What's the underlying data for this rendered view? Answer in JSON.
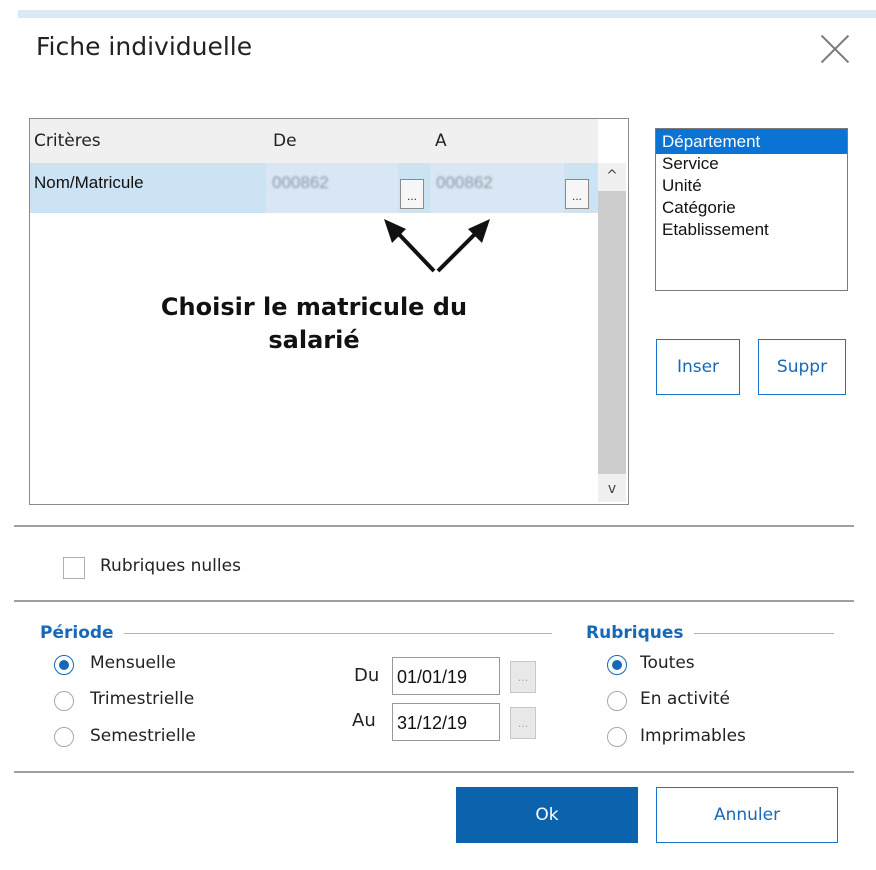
{
  "window": {
    "title": "Fiche individuelle",
    "close_icon": "close-icon"
  },
  "grid": {
    "headers": [
      "Critères",
      "De",
      "A"
    ],
    "rows": [
      {
        "critere": "Nom/Matricule",
        "de": "000862",
        "a": "000862"
      }
    ],
    "ellipsis": "...",
    "scroll_up": "^",
    "scroll_down": "v"
  },
  "annotation": {
    "line1": "Choisir le matricule du",
    "line2": "salarié"
  },
  "criteria_list": {
    "items": [
      "Département",
      "Service",
      "Unité",
      "Catégorie",
      "Etablissement"
    ],
    "selected": "Département"
  },
  "buttons": {
    "inser": "Inser",
    "suppr": "Suppr",
    "ok": "Ok",
    "annuler": "Annuler"
  },
  "options": {
    "rubriques_nulles": "Rubriques nulles",
    "rubriques_nulles_checked": false
  },
  "periode": {
    "title": "Période",
    "options": [
      "Mensuelle",
      "Trimestrielle",
      "Semestrielle"
    ],
    "selected": "Mensuelle",
    "du_label": "Du",
    "du_value": "01/01/19",
    "au_label": "Au",
    "au_value": "31/12/19",
    "picker": "..."
  },
  "rubriques": {
    "title": "Rubriques",
    "options": [
      "Toutes",
      "En activité",
      "Imprimables"
    ],
    "selected": "Toutes"
  },
  "colors": {
    "accent": "#1769b8",
    "ok_bg": "#0b63ad",
    "selection": "#0a73d3",
    "row_bg": "#cce3f4"
  }
}
